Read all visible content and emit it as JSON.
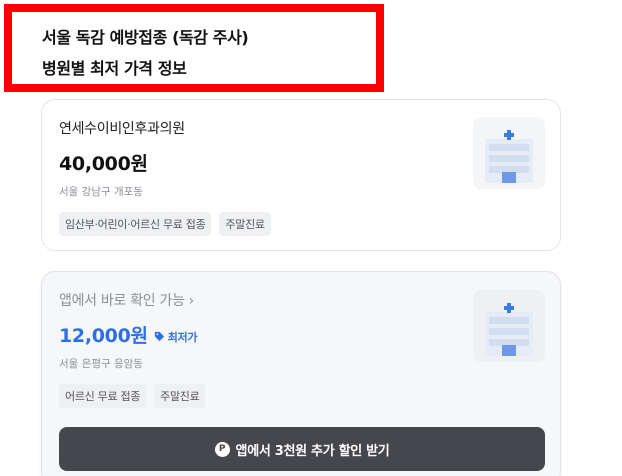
{
  "title": {
    "line1": "서울 독감 예방접종 (독감 주사)",
    "line2": "병원별 최저 가격 정보"
  },
  "cards": [
    {
      "name": "연세수이비인후과의원",
      "price": "40,000원",
      "address": "서울 강남구 개포동",
      "chips": [
        "임산부·어린이·어르신 무료 접종",
        "주말진료"
      ]
    },
    {
      "name": "앱에서 바로 확인 가능",
      "price": "12,000원",
      "badge": "최저가",
      "address": "서울 은평구 응암동",
      "chips": [
        "어르신 무료 접종",
        "주말진료"
      ],
      "cta": "앱에서 3천원 추가 할인 받기",
      "cta_icon": "P"
    }
  ],
  "colors": {
    "accent": "#2f6fe4",
    "highlight_border": "#ff0000",
    "cta_bg": "#45474d"
  },
  "icons": {
    "hospital": "hospital-building-icon",
    "price_tag": "price-tag-icon",
    "chevron": "chevron-right-icon",
    "points": "points-p-icon"
  }
}
